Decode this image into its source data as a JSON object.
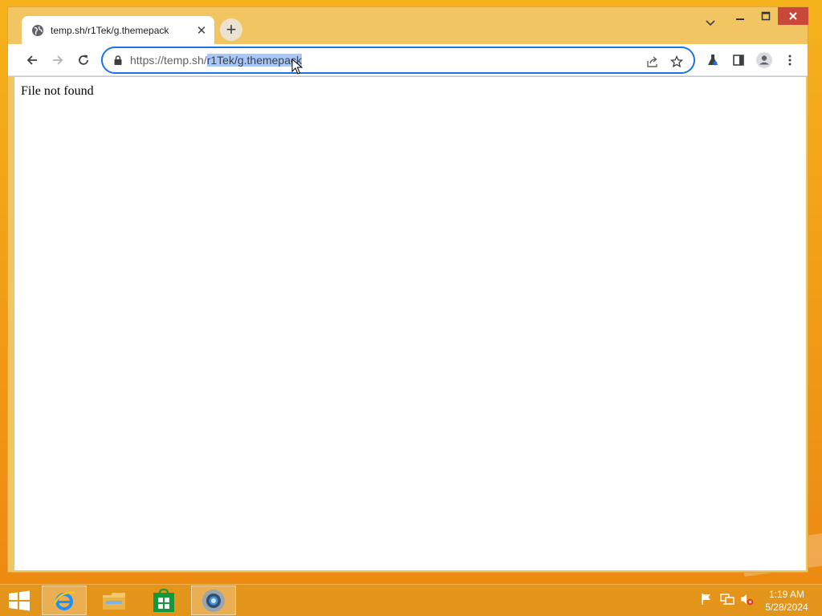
{
  "browser": {
    "tab": {
      "title": "temp.sh/r1Tek/g.themepack",
      "close_glyph": "✕"
    },
    "new_tab_glyph": "+",
    "address_bar": {
      "url_prefix": "https://temp.sh/",
      "url_selected": "r1Tek/g.themepack",
      "full_url": "https://temp.sh/r1Tek/g.themepack"
    },
    "page": {
      "message": "File not found"
    }
  },
  "taskbar": {
    "apps": [
      "internet-explorer",
      "file-explorer",
      "store",
      "chrome"
    ],
    "clock": {
      "time": "1:19 AM",
      "date": "5/28/2024"
    }
  },
  "colors": {
    "wallpaper": "#f3a017",
    "titlebar": "#f1c562",
    "close_button": "#c9483a",
    "omnibox_focus": "#1a73e8",
    "selection": "#a8c7fa",
    "taskbar": "#e3941a"
  }
}
